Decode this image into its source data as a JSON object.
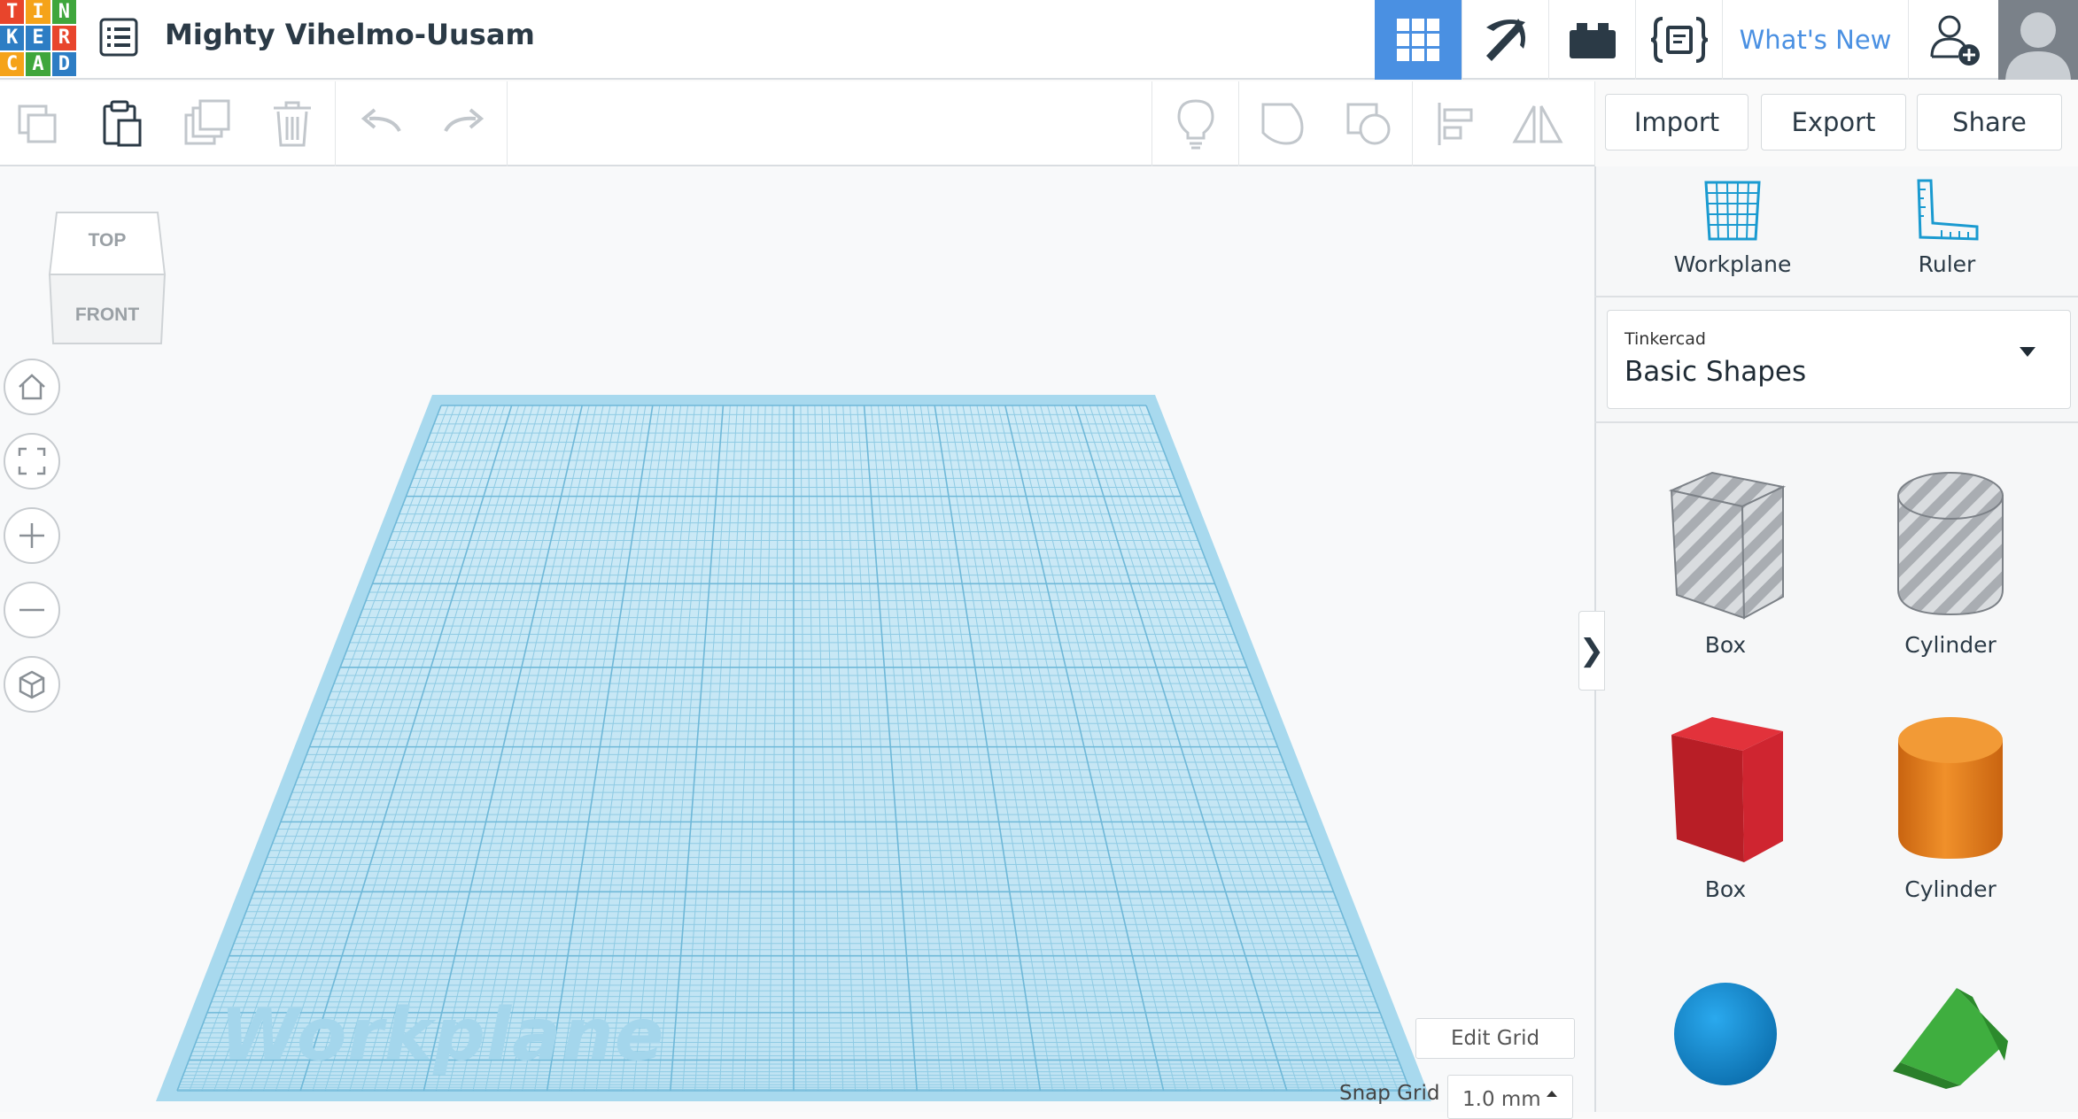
{
  "app": {
    "logo_letters": [
      "T",
      "I",
      "N",
      "K",
      "E",
      "R",
      "C",
      "A",
      "D"
    ],
    "logo_colors": [
      "#e8452c",
      "#f5a31a",
      "#3fa63c",
      "#2d7dc4",
      "#2d7dc4",
      "#e8452c",
      "#f5a31a",
      "#3fa63c",
      "#2d7dc4"
    ],
    "design_title": "Mighty Vihelmo-Uusam",
    "accent": "#4a90e2"
  },
  "topbar": {
    "icons": [
      "grid-view-icon",
      "pickaxe-icon",
      "bricks-icon",
      "codeblocks-icon"
    ],
    "whats_new": "What's New",
    "add_user_icon": "user-add-icon"
  },
  "toolbar": {
    "import_label": "Import",
    "export_label": "Export",
    "share_label": "Share",
    "edit_icons": [
      "copy-icon",
      "paste-icon",
      "duplicate-icon",
      "delete-icon",
      "undo-icon",
      "redo-icon"
    ],
    "view_icons": [
      "note-icon",
      "hole-icon",
      "solid-icon",
      "align-icon",
      "mirror-icon"
    ]
  },
  "viewcube": {
    "top": "TOP",
    "front": "FRONT"
  },
  "nav_buttons": [
    "home-view-icon",
    "fit-view-icon",
    "zoom-in-icon",
    "zoom-out-icon",
    "ortho-view-icon"
  ],
  "workplane": {
    "watermark": "Workplane"
  },
  "panel": {
    "tools": [
      {
        "label": "Workplane",
        "icon": "workplane-icon"
      },
      {
        "label": "Ruler",
        "icon": "ruler-icon"
      }
    ],
    "library_source": "Tinkercad",
    "library_name": "Basic Shapes",
    "shapes": [
      {
        "label": "Box",
        "kind": "hole-box"
      },
      {
        "label": "Cylinder",
        "kind": "hole-cylinder"
      },
      {
        "label": "Box",
        "kind": "box",
        "color": "#d0202a"
      },
      {
        "label": "Cylinder",
        "kind": "cylinder",
        "color": "#e8801c"
      },
      {
        "label": "",
        "kind": "sphere",
        "color": "#1a8fd8"
      },
      {
        "label": "",
        "kind": "roof",
        "color": "#3aa83a"
      }
    ],
    "collapse_glyph": "❯"
  },
  "grid_controls": {
    "edit_grid": "Edit Grid",
    "snap_label": "Snap Grid",
    "snap_value": "1.0 mm"
  }
}
